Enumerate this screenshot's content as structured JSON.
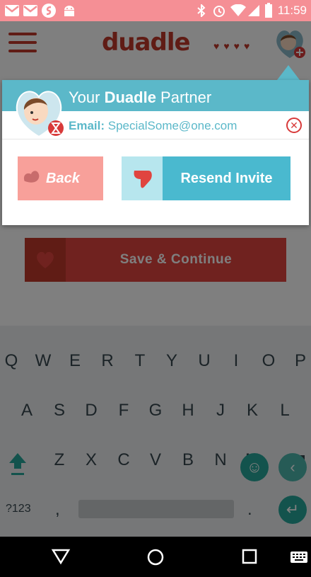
{
  "status_bar": {
    "time": "11:59"
  },
  "header": {
    "logo": "duadle"
  },
  "background": {
    "save_button_label": "Save & Continue"
  },
  "dialog": {
    "title_prefix": "Your ",
    "title_brand": "Duadle",
    "title_suffix": " Partner",
    "email_label": "Email:",
    "email_value": "SpecialSome@one.com",
    "back_label": "Back",
    "resend_label": "Resend Invite"
  },
  "keyboard": {
    "row1": [
      "Q",
      "W",
      "E",
      "R",
      "T",
      "Y",
      "U",
      "I",
      "O",
      "P"
    ],
    "row2": [
      "A",
      "S",
      "D",
      "F",
      "G",
      "H",
      "J",
      "K",
      "L"
    ],
    "row3": [
      "Z",
      "X",
      "C",
      "V",
      "B",
      "N",
      "M"
    ],
    "symbols_label": "?123",
    "comma": ",",
    "period": "."
  },
  "colors": {
    "status": "#f58f95",
    "accent": "#5bb8c9",
    "brand_red": "#c0392b",
    "back": "#f8a09a"
  }
}
